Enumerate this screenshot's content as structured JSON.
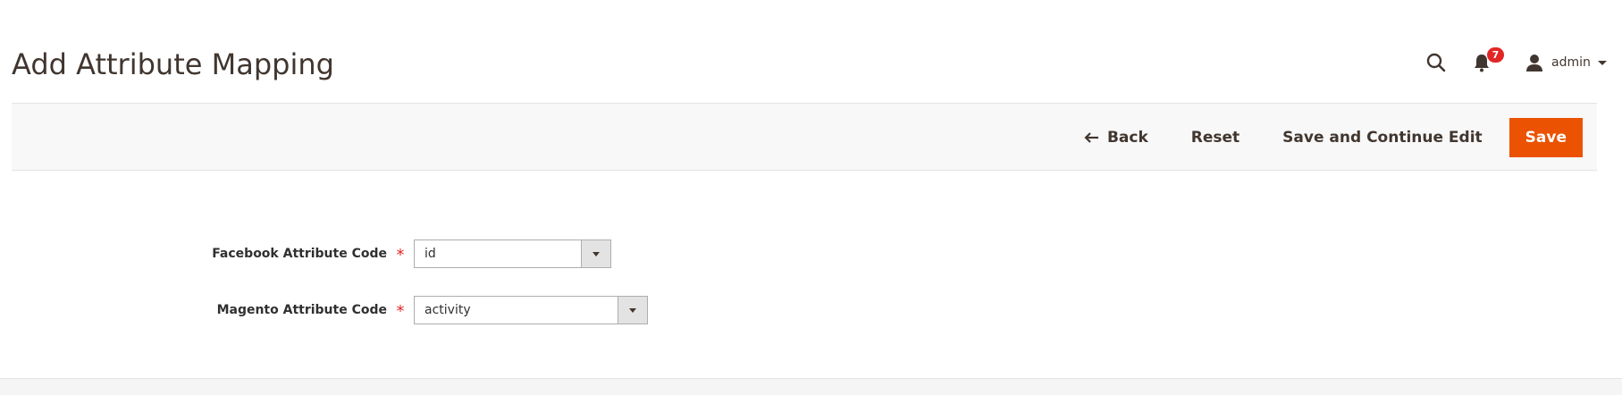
{
  "page": {
    "title": "Add Attribute Mapping"
  },
  "header": {
    "search_icon": "search-icon",
    "notifications": {
      "icon": "bell-icon",
      "count": "7"
    },
    "user": {
      "icon": "user-icon",
      "name": "admin"
    }
  },
  "actions": {
    "back_label": "Back",
    "reset_label": "Reset",
    "save_continue_label": "Save and Continue Edit",
    "save_label": "Save"
  },
  "form": {
    "fields": [
      {
        "label": "Facebook Attribute Code",
        "required": true,
        "value": "id"
      },
      {
        "label": "Magento Attribute Code",
        "required": true,
        "value": "activity"
      }
    ],
    "required_marker": "*"
  },
  "colors": {
    "primary": "#eb5202",
    "required": "#e22626",
    "badge": "#e22626",
    "title": "#41362f"
  }
}
